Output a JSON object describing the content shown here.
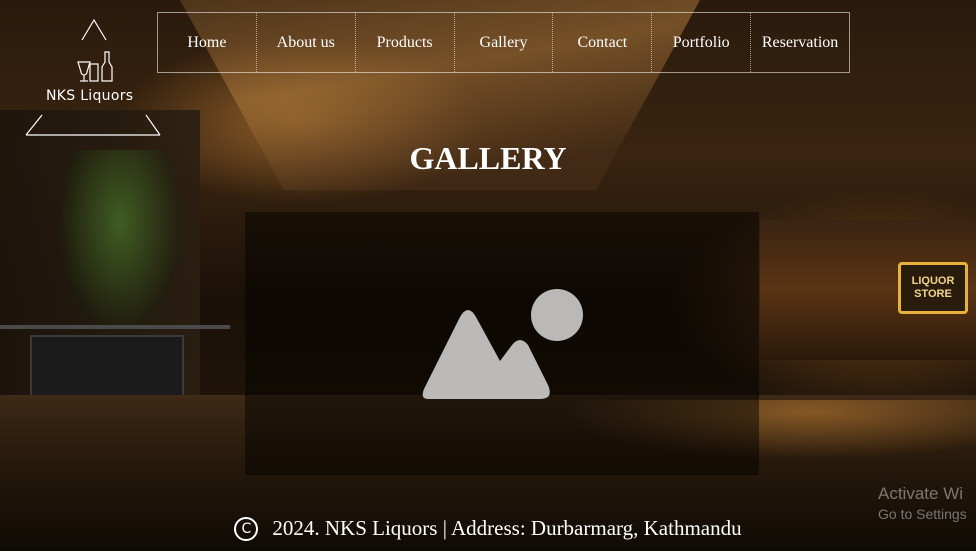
{
  "brand": {
    "name": "NKS Liquors"
  },
  "nav": {
    "items": [
      {
        "label": "Home"
      },
      {
        "label": "About us"
      },
      {
        "label": "Products"
      },
      {
        "label": "Gallery"
      },
      {
        "label": "Contact"
      },
      {
        "label": "Portfolio"
      },
      {
        "label": "Reservation"
      }
    ]
  },
  "page": {
    "title": "GALLERY"
  },
  "gallery": {
    "icon": "image-placeholder-icon"
  },
  "footer": {
    "copyright_symbol": "C",
    "text": "2024. NKS Liquors | Address: Durbarmarg, Kathmandu"
  },
  "scene": {
    "store_sign": "LIQUOR STORE"
  },
  "os_watermark": {
    "line1": "Activate Wi",
    "line2": "Go to Settings"
  },
  "colors": {
    "text": "#ffffff",
    "accent_sign": "#e7b13a"
  }
}
